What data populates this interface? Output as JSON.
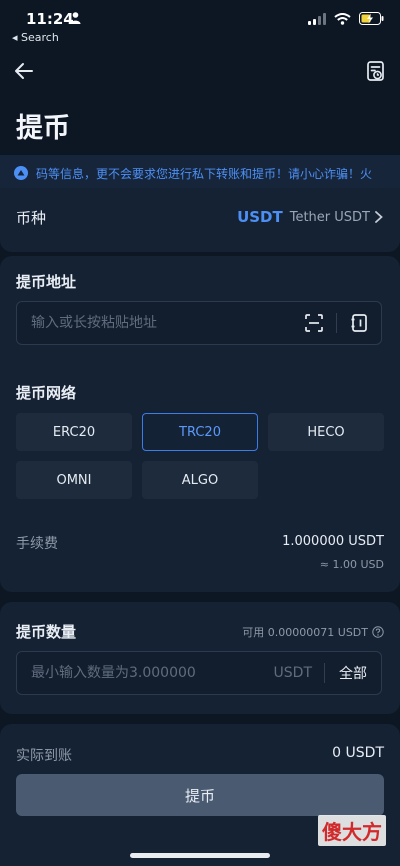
{
  "status_bar": {
    "time": "11:24",
    "back_app": "◂ Search"
  },
  "page": {
    "title": "提币"
  },
  "notice": {
    "text": "码等信息，更不会要求您进行私下转账和提币！请小心诈骗！火"
  },
  "coin": {
    "label": "币种",
    "symbol": "USDT",
    "name": "Tether USDT"
  },
  "address": {
    "label": "提币地址",
    "placeholder": "输入或长按粘贴地址",
    "value": ""
  },
  "network": {
    "label": "提币网络",
    "options": [
      "ERC20",
      "TRC20",
      "HECO",
      "OMNI",
      "ALGO"
    ],
    "selected": "TRC20"
  },
  "fee": {
    "label": "手续费",
    "value": "1.000000 USDT",
    "approx": "≈ 1.00 USD"
  },
  "amount": {
    "label": "提币数量",
    "available": "可用 0.00000071 USDT",
    "placeholder": "最小输入数量为3.000000",
    "unit": "USDT",
    "all_label": "全部"
  },
  "receive": {
    "label": "实际到账",
    "value": "0 USDT"
  },
  "submit": {
    "label": "提币"
  },
  "watermark": {
    "text": "傻大方"
  },
  "colors": {
    "accent": "#4d90f5",
    "background": "#0d1724",
    "card": "#152233"
  }
}
